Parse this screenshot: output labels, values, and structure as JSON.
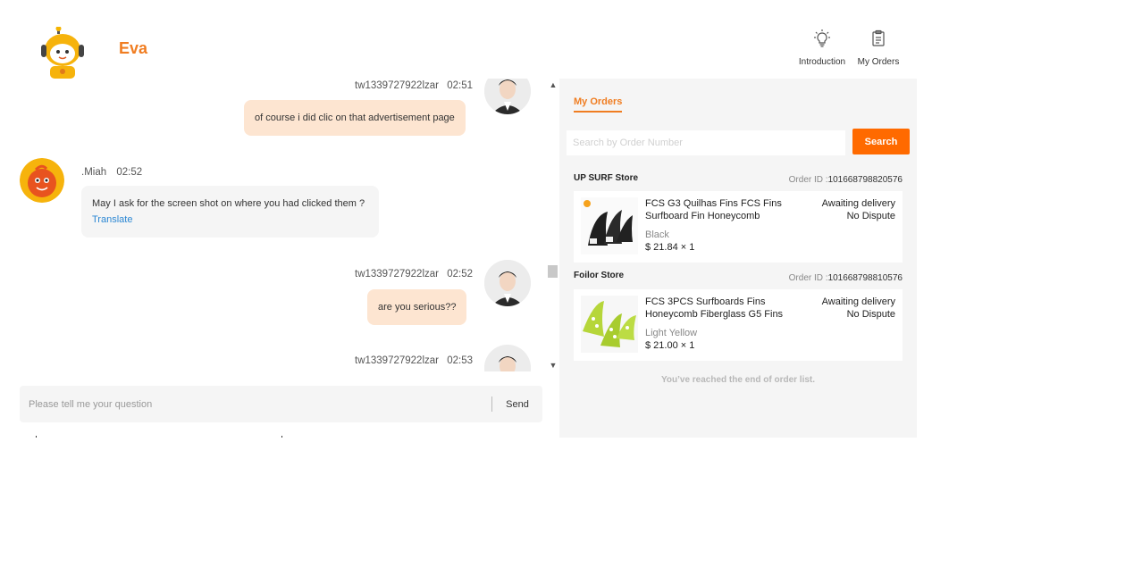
{
  "header": {
    "bot_name": "Eva",
    "buttons": [
      {
        "label": "Introduction",
        "icon": "lightbulb-icon"
      },
      {
        "label": "My Orders",
        "icon": "clipboard-icon"
      }
    ]
  },
  "chat": {
    "messages": [
      {
        "sender": "tw1339727922lzar",
        "time": "02:51",
        "text": "of course i did clic on that advertisement page",
        "role": "user"
      },
      {
        "sender": ".Miah",
        "time": "02:52",
        "text": "May I ask for the screen shot on where you had clicked them ?",
        "translate": "Translate",
        "role": "agent"
      },
      {
        "sender": "tw1339727922lzar",
        "time": "02:52",
        "text": "are you serious??",
        "role": "user"
      },
      {
        "sender": "tw1339727922lzar",
        "time": "02:53",
        "text": "",
        "role": "user"
      }
    ],
    "input_placeholder": "Please tell me your question",
    "send_label": "Send"
  },
  "orders": {
    "tab_label": "My Orders",
    "search_placeholder": "Search by Order Number",
    "search_label": "Search",
    "order_id_prefix": "Order ID :",
    "items": [
      {
        "store": "UP SURF Store",
        "order_id": "101668798820576",
        "title": "FCS G3 Quilhas Fins FCS Fins Surfboard Fin Honeycomb",
        "variant": "Black",
        "price": "$ 21.84 × 1",
        "status": "Awaiting delivery",
        "dispute": "No Dispute"
      },
      {
        "store": "Foilor Store",
        "order_id": "101668798810576",
        "title": "FCS 3PCS Surfboards Fins Honeycomb Fiberglass G5 Fins",
        "variant": "Light Yellow",
        "price": "$ 21.00 × 1",
        "status": "Awaiting delivery",
        "dispute": "No Dispute"
      }
    ],
    "end_note": "You’ve reached the end of order list."
  },
  "colors": {
    "accent": "#f07d21",
    "search_button": "#ff6a00",
    "user_bubble": "#fde5d1",
    "agent_bubble": "#f5f5f5",
    "link": "#2b87d3"
  }
}
